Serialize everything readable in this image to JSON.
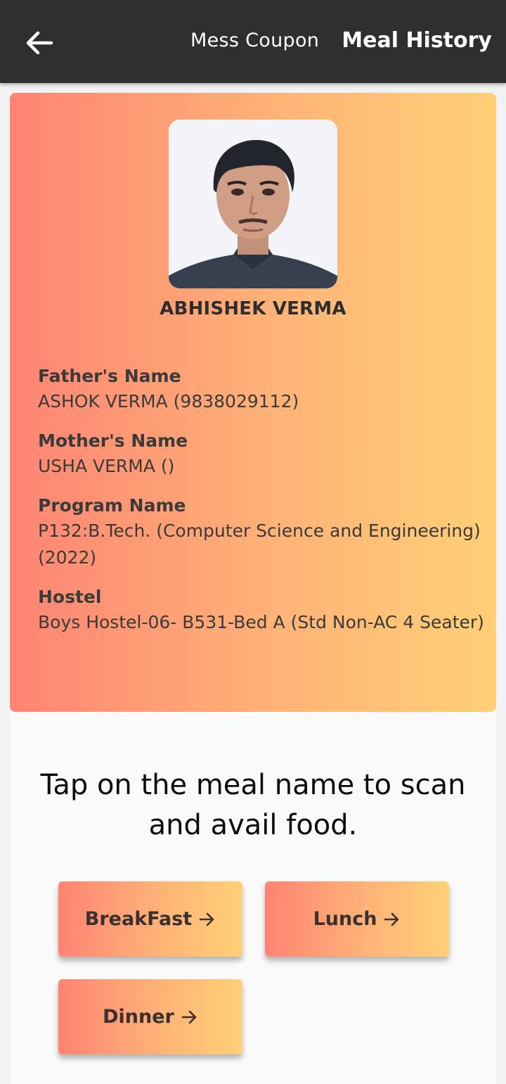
{
  "appbar": {
    "title": "Mess Coupon",
    "action": "Meal History",
    "back_icon": "arrow-left-icon"
  },
  "profile": {
    "photo": "student-photo",
    "name": "ABHISHEK VERMA",
    "fields": [
      {
        "label": "Father's Name",
        "value": "ASHOK VERMA (9838029112)"
      },
      {
        "label": "Mother's Name",
        "value": "USHA VERMA ()"
      },
      {
        "label": "Program Name",
        "value": "P132:B.Tech. (Computer Science and Engineering) (2022)"
      },
      {
        "label": "Hostel",
        "value": "Boys Hostel-06- B531-Bed A (Std Non-AC 4 Seater)"
      }
    ]
  },
  "instruction": "Tap on the meal name to scan and avail food.",
  "meals": [
    {
      "label": "BreakFast"
    },
    {
      "label": "Lunch"
    },
    {
      "label": "Dinner"
    }
  ],
  "colors": {
    "appbar": "#2f2f2f",
    "gradient_start": "#ff8473",
    "gradient_end": "#fed077"
  }
}
